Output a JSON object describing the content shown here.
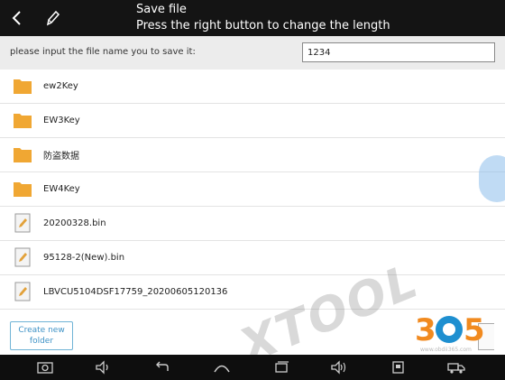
{
  "header": {
    "title": "Save file",
    "subtitle": "Press the right button to change the length"
  },
  "form": {
    "prompt": "please input the file name you to save it:",
    "file_name_value": "1234"
  },
  "files": [
    {
      "name": "ew2Key",
      "type": "folder",
      "icon": "folder-icon"
    },
    {
      "name": "EW3Key",
      "type": "folder",
      "icon": "folder-icon"
    },
    {
      "name": "防盗数据",
      "type": "folder",
      "icon": "folder-icon"
    },
    {
      "name": "EW4Key",
      "type": "folder",
      "icon": "folder-icon"
    },
    {
      "name": "20200328.bin",
      "type": "file",
      "icon": "document-icon"
    },
    {
      "name": "95128-2(New).bin",
      "type": "file",
      "icon": "document-icon"
    },
    {
      "name": "LBVCU5104DSF17759_20200605120136",
      "type": "file",
      "icon": "document-icon"
    }
  ],
  "actions": {
    "create_folder_label": "Create new folder"
  },
  "navbar": {
    "icons": [
      "camera-icon",
      "volume-down-icon",
      "back-icon",
      "home-icon",
      "recent-apps-icon",
      "volume-up-icon",
      "device-icon",
      "truck-icon"
    ]
  },
  "watermark": {
    "text": "XTOOL",
    "logo_text": "365",
    "logo_url": "www.obdii365.com"
  },
  "colors": {
    "topbar": "#141414",
    "folder": "#f0a733",
    "accent": "#3e92c6"
  }
}
